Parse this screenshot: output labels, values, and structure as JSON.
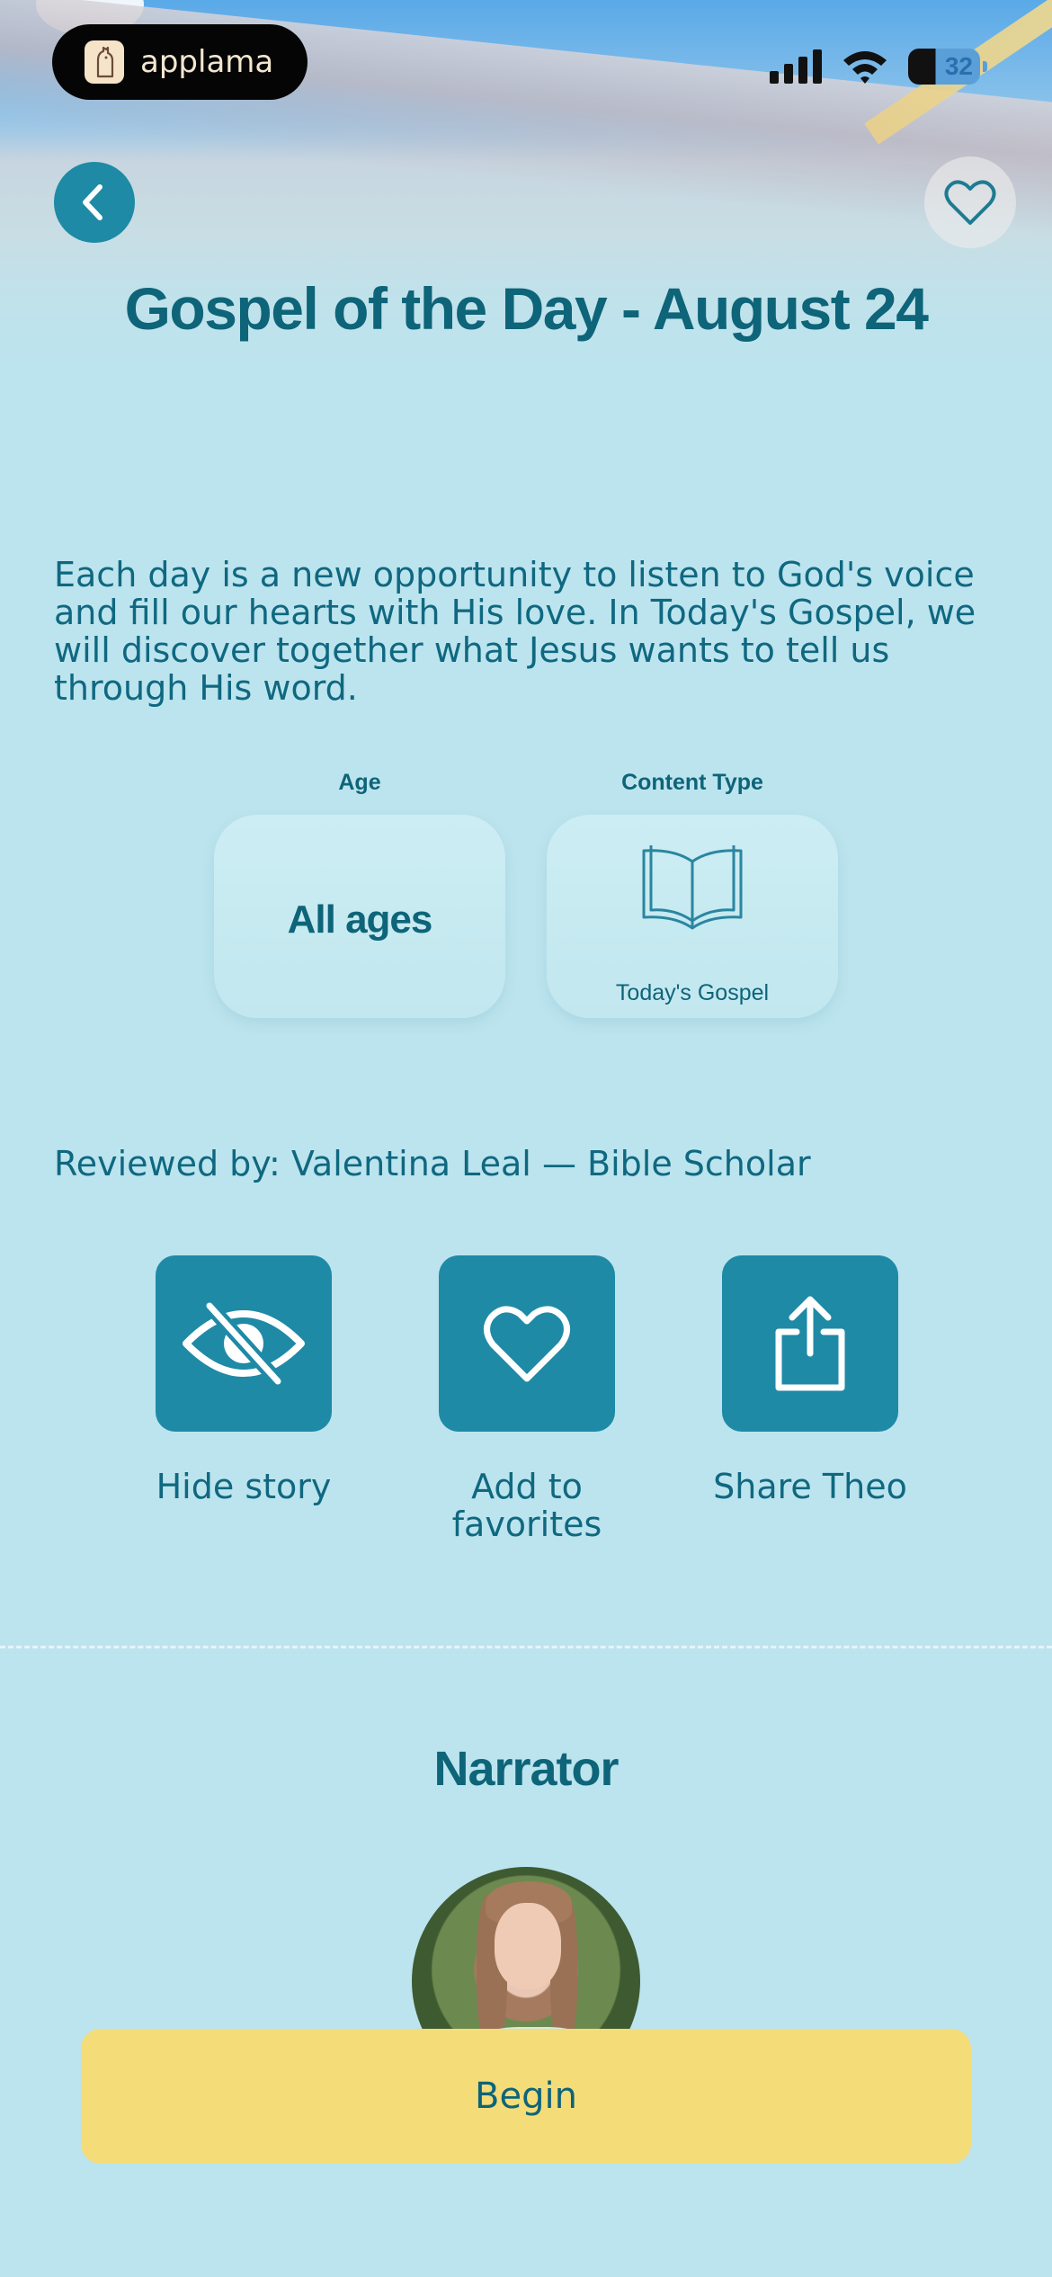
{
  "status_bar": {
    "app_badge": "applama",
    "battery": "32"
  },
  "header": {
    "title": "Gospel of the Day - August 24"
  },
  "description": "Each day is a new opportunity to listen to God's voice and fill our hearts with His love. In Today's Gospel, we will discover together what Jesus wants to tell us through His word.",
  "info": {
    "age_label": "Age",
    "age_value": "All ages",
    "content_type_label": "Content Type",
    "content_type_value": "Today's Gospel"
  },
  "reviewed_by": "Reviewed by: Valentina Leal — Bible Scholar",
  "actions": [
    {
      "label": "Hide story",
      "icon": "eye-slash-icon"
    },
    {
      "label": "Add to favorites",
      "icon": "heart-icon"
    },
    {
      "label": "Share Theo",
      "icon": "share-icon"
    }
  ],
  "narrator": {
    "title": "Narrator"
  },
  "begin_button": "Begin",
  "colors": {
    "background": "#bce4ee",
    "primary": "#1e8aa6",
    "text": "#0e6478",
    "begin": "#f4dc78"
  }
}
